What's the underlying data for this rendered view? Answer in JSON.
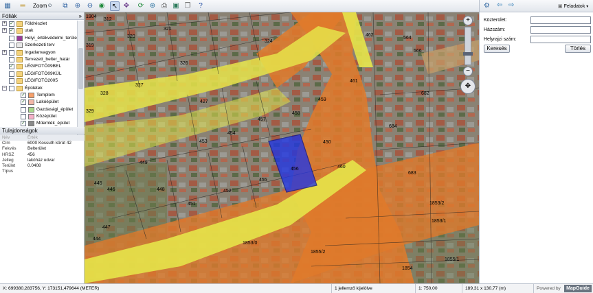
{
  "toolbar": {
    "zoom_label": "Zoom",
    "tools": [
      "layers-toggle-icon",
      "measure-icon",
      "print-view-icon",
      "zoom-in-icon",
      "zoom-out-icon",
      "zoom-extent-icon",
      "select-pointer-icon",
      "pan-icon",
      "refresh-icon",
      "back-icon",
      "print-icon",
      "buffer-icon",
      "copy-icon",
      "help-icon"
    ]
  },
  "layers_panel": {
    "title": "Fóliák",
    "items": [
      {
        "label": "Földrészlet",
        "checked": true,
        "expander": "+",
        "swatch": "folder"
      },
      {
        "label": "utak",
        "checked": true,
        "expander": "+",
        "swatch": "folder"
      },
      {
        "label": "Helyi_értékvédelmi_terület",
        "checked": false,
        "expander": "",
        "swatch": "#9a3a9a"
      },
      {
        "label": "Szerkezeti terv",
        "checked": false,
        "expander": "",
        "swatch": "#e8e8e8"
      },
      {
        "label": "Ingatlanvagyon",
        "checked": false,
        "expander": "+",
        "swatch": "folder"
      },
      {
        "label": "Tervezett_belter_határ",
        "checked": false,
        "expander": "",
        "swatch": "folder"
      },
      {
        "label": "LÉGIFOTÓ09BEL",
        "checked": true,
        "expander": "",
        "swatch": "folder"
      },
      {
        "label": "LÉGIFOTÓ09KÜL",
        "checked": false,
        "expander": "",
        "swatch": "folder"
      },
      {
        "label": "LÉGIFOTÓ2005",
        "checked": false,
        "expander": "",
        "swatch": "folder"
      },
      {
        "label": "Épületek",
        "checked": false,
        "expander": "−",
        "swatch": "folder"
      },
      {
        "label": "Templom",
        "checked": true,
        "expander": "",
        "swatch": "#f7a06a",
        "indent": true
      },
      {
        "label": "Lakóépület",
        "checked": true,
        "expander": "",
        "swatch": "#f2b7a8",
        "indent": true
      },
      {
        "label": "Gazdasági_épület",
        "checked": false,
        "expander": "",
        "swatch": "#a8d88a",
        "indent": true
      },
      {
        "label": "Középület",
        "checked": false,
        "expander": "",
        "swatch": "#f6b0c8",
        "indent": true
      },
      {
        "label": "Műemlék_épület",
        "checked": true,
        "expander": "",
        "swatch": "#8a8a8a",
        "indent": true
      }
    ]
  },
  "properties_panel": {
    "title": "Tulajdonságok",
    "header": {
      "key": "Név",
      "value": "Érték"
    },
    "rows": [
      {
        "key": "Cím",
        "value": "6000 Kossuth körút 42"
      },
      {
        "key": "Fekvés",
        "value": "Belterület"
      },
      {
        "key": "HRSZ",
        "value": "456"
      },
      {
        "key": "Jelleg",
        "value": "lakóház udvar"
      },
      {
        "key": "Terület",
        "value": "0.0408"
      },
      {
        "key": "Típus",
        "value": ""
      }
    ]
  },
  "map": {
    "parcel_labels": [
      "312",
      "321",
      "320",
      "319",
      "326",
      "324",
      "328",
      "327",
      "329",
      "427",
      "459",
      "458",
      "457",
      "454",
      "453",
      "450",
      "449",
      "446",
      "445",
      "448",
      "447",
      "444",
      "452",
      "451",
      "455",
      "456",
      "460",
      "461",
      "462",
      "564",
      "566",
      "682",
      "684",
      "683",
      "1853/2",
      "1853/1",
      "1853/0",
      "1855/2",
      "1855/1",
      "1854",
      "1910",
      "1904"
    ],
    "colors": {
      "road_orange": "#e07a2a",
      "road_yellow": "#e6e44a",
      "selection_blue": "#1f35e6"
    }
  },
  "search_panel": {
    "tasks_label": "Feladatok",
    "fields": [
      {
        "label": "Közterület:",
        "value": ""
      },
      {
        "label": "Házszám:",
        "value": ""
      },
      {
        "label": "Helyrajzi szám:",
        "value": ""
      }
    ],
    "search_button": "Keresés",
    "clear_button": "Törlés"
  },
  "status_bar": {
    "coordinates": "X: 699380,283756, Y: 173151,479644 (METER)",
    "selection": "1 jellemző kijelölve",
    "scale": "1: 750,00",
    "extent": "189,31 x 130,77 (m)",
    "powered_by": "Powered by",
    "brand": "MapGuide"
  }
}
